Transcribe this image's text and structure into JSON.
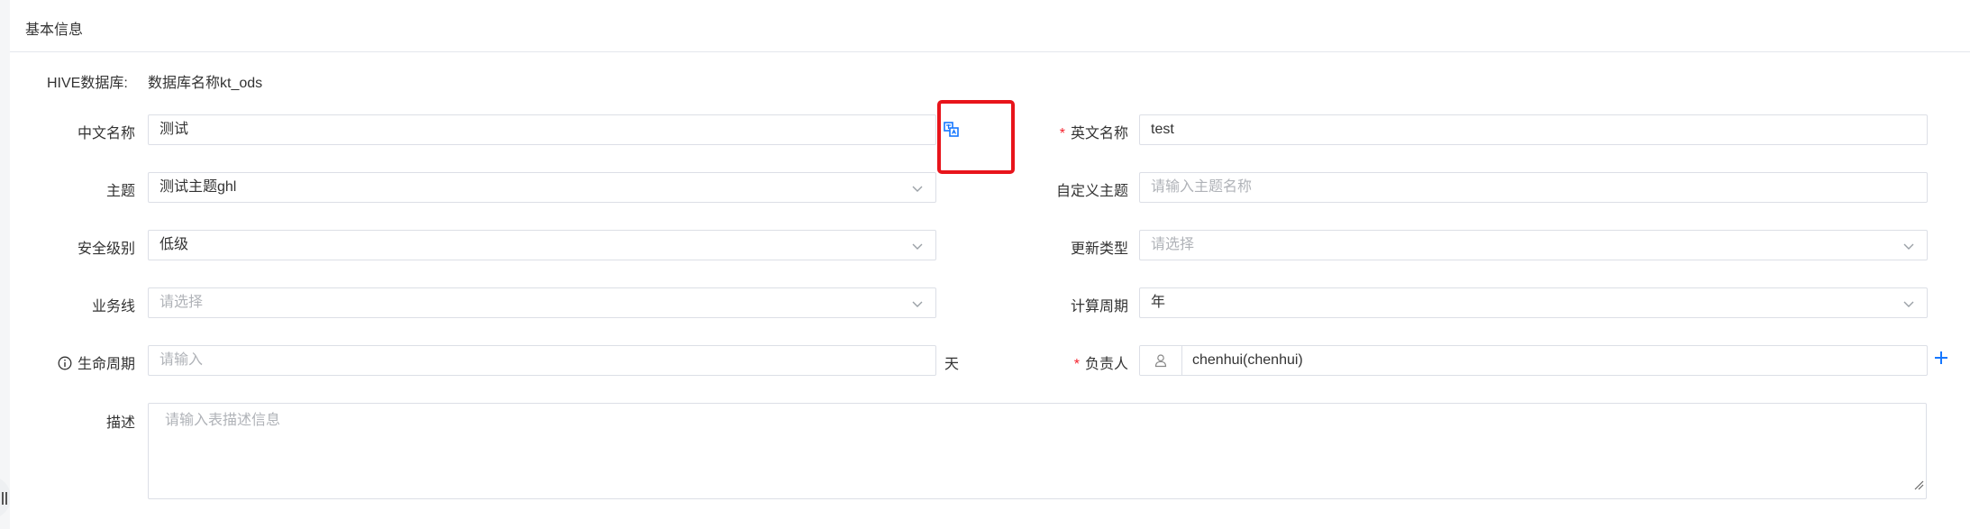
{
  "card": {
    "title": "基本信息"
  },
  "form": {
    "hive": {
      "label": "HIVE数据库:",
      "value": "数据库名称kt_ods"
    },
    "cn_name": {
      "label": "中文名称",
      "value": "测试"
    },
    "en_name": {
      "required": "*",
      "label": "英文名称",
      "value": "test"
    },
    "theme": {
      "label": "主题",
      "value": "测试主题ghl"
    },
    "custom_theme": {
      "label": "自定义主题",
      "placeholder": "请输入主题名称"
    },
    "security": {
      "label": "安全级别",
      "value": "低级"
    },
    "update_type": {
      "label": "更新类型",
      "placeholder": "请选择"
    },
    "business": {
      "label": "业务线",
      "placeholder": "请选择"
    },
    "period": {
      "label": "计算周期",
      "value": "年"
    },
    "lifecycle": {
      "label": "生命周期",
      "placeholder": "请输入",
      "unit": "天"
    },
    "owner": {
      "required": "*",
      "label": "负责人",
      "value": "chenhui(chenhui)"
    },
    "desc": {
      "label": "描述",
      "placeholder": "请输入表描述信息"
    }
  },
  "icons": {
    "translate": "translate-icon",
    "chevron": "chevron-down-icon",
    "info": "info-icon",
    "user": "user-icon",
    "add": "plus-icon"
  },
  "colors": {
    "accent": "#1677ff",
    "required": "#f5222d",
    "highlight": "#e8141b"
  }
}
